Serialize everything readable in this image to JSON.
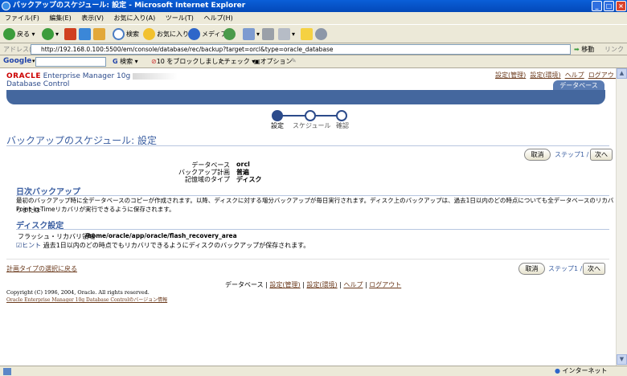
{
  "window": {
    "title": "バックアップのスケジュール: 設定 - Microsoft Internet Explorer",
    "controls": [
      "_",
      "□",
      "×"
    ]
  },
  "menu": [
    "ファイル(F)",
    "編集(E)",
    "表示(V)",
    "お気に入り(A)",
    "ツール(T)",
    "ヘルプ(H)"
  ],
  "toolbar": {
    "back": "戻る",
    "search": "検索",
    "favorites": "お気に入り",
    "media": "メディア"
  },
  "address": {
    "label": "アドレス(D)",
    "url": "http://192.168.0.100:5500/em/console/database/rec/backup?target=orcl&type=oracle_database",
    "go": "移動",
    "links": "リンク"
  },
  "google": {
    "logo": "Google",
    "search": "検索",
    "blocked": "10 をブロックしました",
    "check": "チェック",
    "options": "オプション"
  },
  "header": {
    "oracle": "ORACLE",
    "product": "Enterprise Manager 10g",
    "subtitle": "Database Control",
    "links": [
      "設定(管理)",
      "設定(環境)",
      "ヘルプ",
      "ログアウト"
    ],
    "tab": "データベース"
  },
  "train": {
    "steps": [
      "設定",
      "スケジュール",
      "確認"
    ],
    "current": 0
  },
  "page": {
    "title": "バックアップのスケジュール: 設定",
    "cancel": "取消",
    "step_label": "ステップ1 / 3",
    "next": "次へ"
  },
  "info": [
    {
      "label": "データベース",
      "value": "orcl"
    },
    {
      "label": "バックアップ計画",
      "value": "普遍"
    },
    {
      "label": "記憶域のタイプ",
      "value": "ディスク"
    }
  ],
  "daily": {
    "heading": "日次バックアップ",
    "text1": "最初のバックアップ時に全データベースのコピーが作成されます。以降、ディスクに対する増分バックアップが毎日実行されます。ディスク上のバックアップは、過去1日以内のどの時点についても全データベースのリカバリまたは",
    "text2": "Point-in-Timeリカバリが実行できるように保存されます。"
  },
  "disk": {
    "heading": "ディスク設定",
    "area_label": "フラッシュ・リカバリ領域",
    "area_value": "/home/oracle/app/oracle/flash_recovery_area",
    "hint_label": "ヒント",
    "hint_text": "過去1日以内のどの時点でもリカバリできるようにディスクのバックアップが保存されます。"
  },
  "footer": {
    "back_link": "計画タイプの選択に戻る",
    "nav": [
      "データベース",
      "設定(管理)",
      "設定(環境)",
      "ヘルプ",
      "ログアウト"
    ],
    "copyright": "Copyright (C) 1996, 2004, Oracle. All rights reserved.",
    "version_link": "Oracle Enterprise Manager 10g Database Controlのバージョン情報"
  },
  "status": {
    "zone": "インターネット"
  }
}
